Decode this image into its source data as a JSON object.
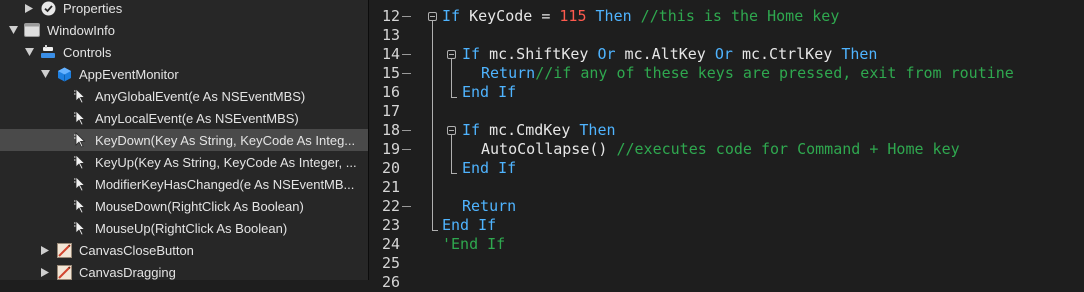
{
  "navigator": {
    "items": [
      {
        "label": "Properties"
      },
      {
        "label": "WindowInfo"
      },
      {
        "label": "Controls"
      },
      {
        "label": "AppEventMonitor"
      },
      {
        "label": "AnyGlobalEvent(e As NSEventMBS)"
      },
      {
        "label": "AnyLocalEvent(e As NSEventMBS)"
      },
      {
        "label": "KeyDown(Key As String, KeyCode As Integ..."
      },
      {
        "label": "KeyUp(Key As String, KeyCode As Integer, ..."
      },
      {
        "label": "ModifierKeyHasChanged(e As NSEventMB..."
      },
      {
        "label": "MouseDown(RightClick As Boolean)"
      },
      {
        "label": "MouseUp(RightClick As Boolean)"
      },
      {
        "label": "CanvasCloseButton"
      },
      {
        "label": "CanvasDragging"
      }
    ]
  },
  "editor": {
    "line_numbers": [
      "12",
      "13",
      "14",
      "15",
      "16",
      "17",
      "18",
      "19",
      "20",
      "21",
      "22",
      "23",
      "24",
      "25",
      "26"
    ],
    "l12": {
      "kw_if": "If",
      "ident": " KeyCode = ",
      "num": "115",
      "kw_then": " Then",
      "comment": " //this is the Home key"
    },
    "l14": {
      "kw_if": "If",
      "t1": " mc.ShiftKey ",
      "kw_or1": "Or",
      "t2": " mc.AltKey ",
      "kw_or2": "Or",
      "t3": " mc.CtrlKey ",
      "kw_then": "Then"
    },
    "l15": {
      "kw": "Return",
      "comment": "//if any of these keys are pressed, exit from routine"
    },
    "l16": {
      "kw": "End If"
    },
    "l18": {
      "kw_if": "If",
      "t1": " mc.CmdKey ",
      "kw_then": "Then"
    },
    "l19": {
      "text": "AutoCollapse() ",
      "comment": "//executes code for Command + Home key"
    },
    "l20": {
      "kw": "End If"
    },
    "l22": {
      "kw": "Return"
    },
    "l23": {
      "kw": "End If"
    },
    "l24": {
      "comment": "'End If"
    }
  },
  "colors": {
    "keyword": "#4fb4ff",
    "number": "#ff5a4e",
    "comment": "#2fa84f",
    "selection": "#4a4a4a"
  }
}
